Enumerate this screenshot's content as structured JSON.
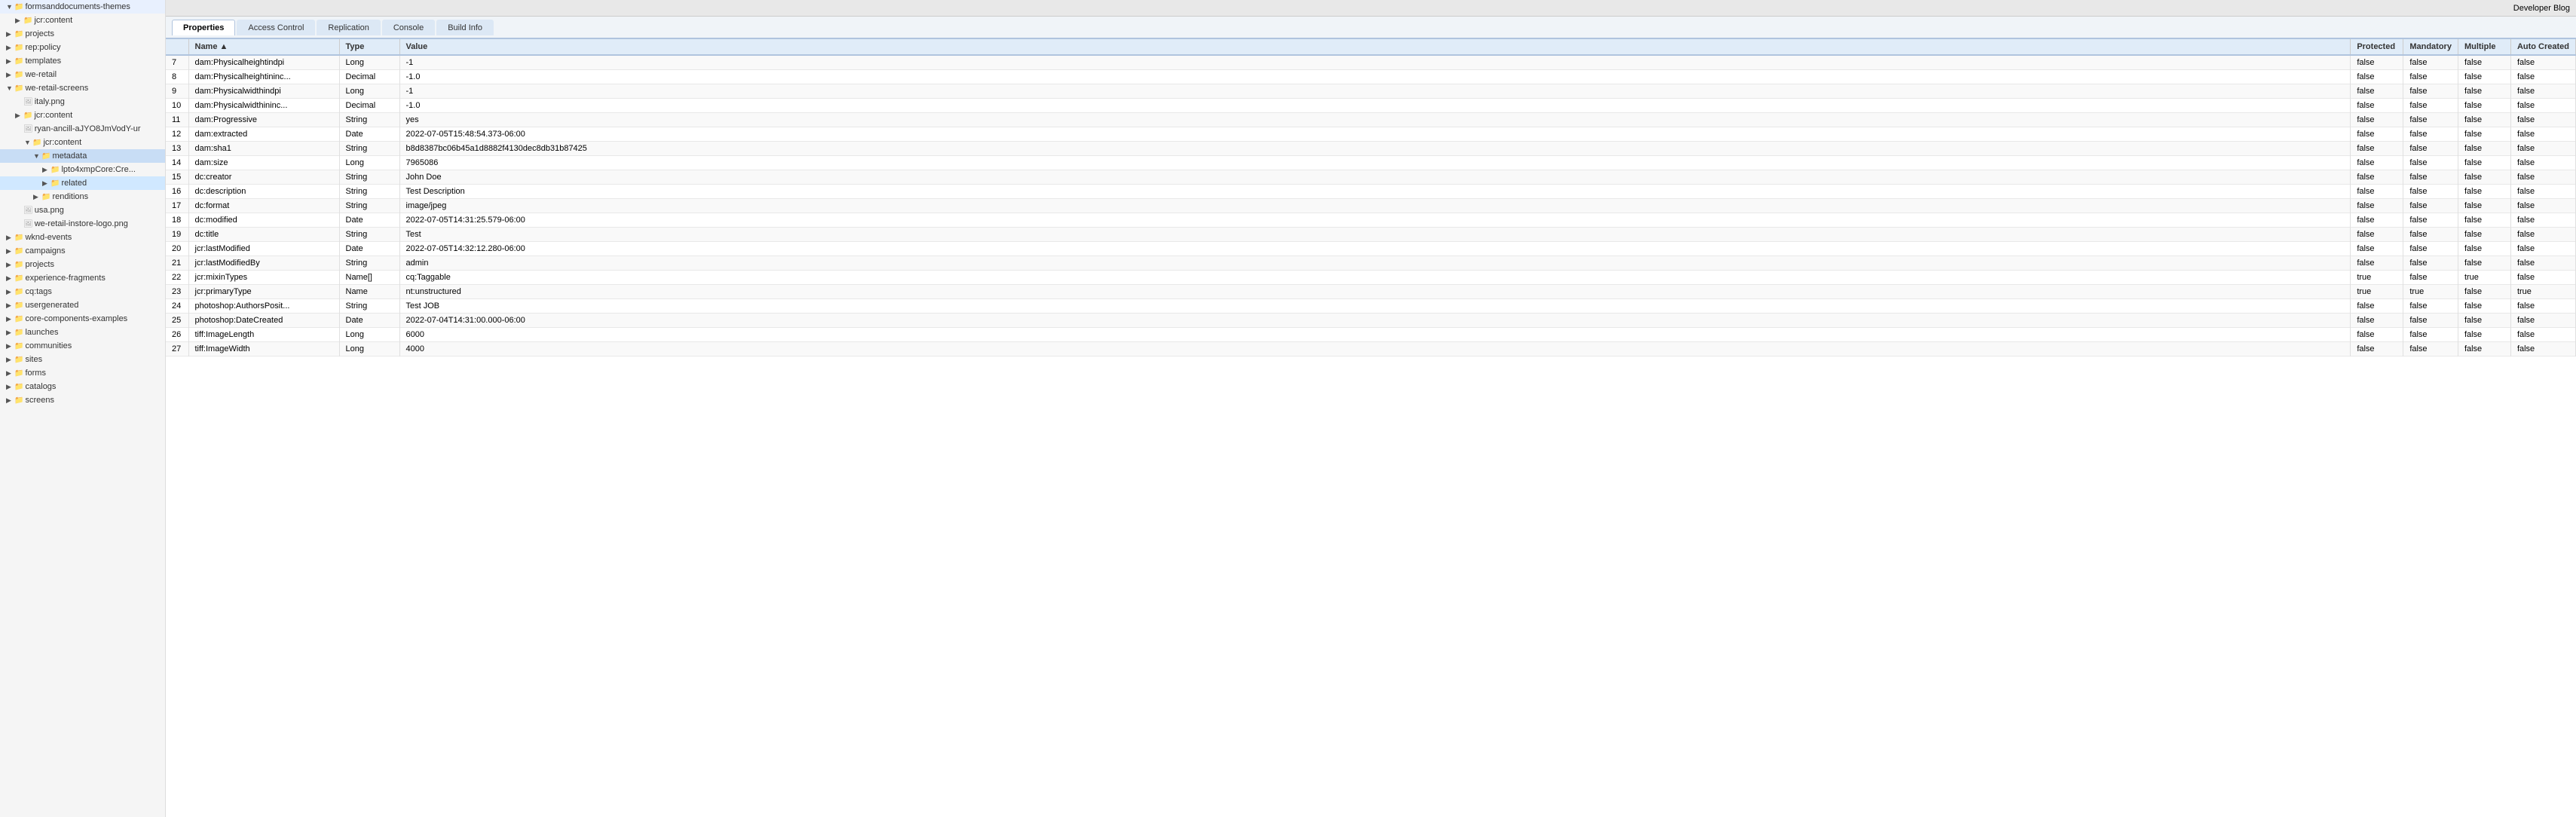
{
  "sidebar": {
    "items": [
      {
        "id": "formsanddocuments-themes",
        "label": "formsanddocuments-themes",
        "indent": 1,
        "type": "folder",
        "expanded": true
      },
      {
        "id": "jcr-content",
        "label": "jcr:content",
        "indent": 2,
        "type": "folder",
        "expanded": false
      },
      {
        "id": "projects",
        "label": "projects",
        "indent": 1,
        "type": "folder",
        "expanded": false
      },
      {
        "id": "rep-policy",
        "label": "rep:policy",
        "indent": 1,
        "type": "folder",
        "expanded": false
      },
      {
        "id": "templates",
        "label": "templates",
        "indent": 1,
        "type": "folder",
        "expanded": false
      },
      {
        "id": "we-retail",
        "label": "we-retail",
        "indent": 1,
        "type": "folder",
        "expanded": false
      },
      {
        "id": "we-retail-screens",
        "label": "we-retail-screens",
        "indent": 1,
        "type": "folder",
        "expanded": true
      },
      {
        "id": "italy-png",
        "label": "italy.png",
        "indent": 2,
        "type": "file-img",
        "expanded": false
      },
      {
        "id": "jcr-content-2",
        "label": "jcr:content",
        "indent": 2,
        "type": "folder",
        "expanded": false
      },
      {
        "id": "ryan-ancill",
        "label": "ryan-ancill-aJYO8JmVodY-ur",
        "indent": 2,
        "type": "file-img",
        "expanded": true
      },
      {
        "id": "jcr-content-3",
        "label": "jcr:content",
        "indent": 3,
        "type": "folder",
        "expanded": true
      },
      {
        "id": "metadata",
        "label": "metadata",
        "indent": 4,
        "type": "folder",
        "expanded": true,
        "selected": true
      },
      {
        "id": "lpto4xmpCore-Cre",
        "label": "lpto4xmpCore:Cre...",
        "indent": 5,
        "type": "folder",
        "expanded": false
      },
      {
        "id": "related",
        "label": "related",
        "indent": 5,
        "type": "folder",
        "expanded": false,
        "highlighted": true
      },
      {
        "id": "renditions",
        "label": "renditions",
        "indent": 4,
        "type": "folder",
        "expanded": false
      },
      {
        "id": "usa-png",
        "label": "usa.png",
        "indent": 2,
        "type": "file-img",
        "expanded": false
      },
      {
        "id": "we-retail-instore-logo",
        "label": "we-retail-instore-logo.png",
        "indent": 2,
        "type": "file-img",
        "expanded": false
      },
      {
        "id": "wknd-events",
        "label": "wknd-events",
        "indent": 1,
        "type": "folder",
        "expanded": false
      },
      {
        "id": "campaigns",
        "label": "campaigns",
        "indent": 1,
        "type": "folder",
        "expanded": false
      },
      {
        "id": "projects-2",
        "label": "projects",
        "indent": 1,
        "type": "folder",
        "expanded": false
      },
      {
        "id": "experience-fragments",
        "label": "experience-fragments",
        "indent": 1,
        "type": "folder",
        "expanded": false
      },
      {
        "id": "cq-tags",
        "label": "cq:tags",
        "indent": 1,
        "type": "folder",
        "expanded": false
      },
      {
        "id": "usergenerated",
        "label": "usergenerated",
        "indent": 1,
        "type": "folder",
        "expanded": false
      },
      {
        "id": "core-components-examples",
        "label": "core-components-examples",
        "indent": 1,
        "type": "folder",
        "expanded": false
      },
      {
        "id": "launches",
        "label": "launches",
        "indent": 1,
        "type": "folder",
        "expanded": false
      },
      {
        "id": "communities",
        "label": "communities",
        "indent": 1,
        "type": "folder",
        "expanded": false
      },
      {
        "id": "sites",
        "label": "sites",
        "indent": 1,
        "type": "folder",
        "expanded": false
      },
      {
        "id": "forms",
        "label": "forms",
        "indent": 1,
        "type": "folder",
        "expanded": false
      },
      {
        "id": "catalogs",
        "label": "catalogs",
        "indent": 1,
        "type": "folder",
        "expanded": false
      },
      {
        "id": "screens",
        "label": "screens",
        "indent": 1,
        "type": "folder",
        "expanded": false
      }
    ]
  },
  "topbar": {
    "developer_blog_label": "Developer Blog"
  },
  "tabs": [
    {
      "id": "properties",
      "label": "Properties",
      "active": true
    },
    {
      "id": "access-control",
      "label": "Access Control",
      "active": false
    },
    {
      "id": "replication",
      "label": "Replication",
      "active": false
    },
    {
      "id": "console",
      "label": "Console",
      "active": false
    },
    {
      "id": "build-info",
      "label": "Build Info",
      "active": false
    }
  ],
  "table": {
    "headers": [
      {
        "id": "num",
        "label": ""
      },
      {
        "id": "name",
        "label": "Name",
        "sort": "asc"
      },
      {
        "id": "type",
        "label": "Type"
      },
      {
        "id": "value",
        "label": "Value"
      },
      {
        "id": "protected",
        "label": "Protected"
      },
      {
        "id": "mandatory",
        "label": "Mandatory"
      },
      {
        "id": "multiple",
        "label": "Multiple"
      },
      {
        "id": "auto-created",
        "label": "Auto Created"
      }
    ],
    "rows": [
      {
        "num": 7,
        "name": "dam:Physicalheightindpi",
        "type": "Long",
        "value": "-1",
        "protected": "false",
        "mandatory": "false",
        "multiple": "false",
        "auto_created": "false",
        "highlighted": false
      },
      {
        "num": 8,
        "name": "dam:Physicalheightininc...",
        "type": "Decimal",
        "value": "-1.0",
        "protected": "false",
        "mandatory": "false",
        "multiple": "false",
        "auto_created": "false",
        "highlighted": false
      },
      {
        "num": 9,
        "name": "dam:Physicalwidthindpi",
        "type": "Long",
        "value": "-1",
        "protected": "false",
        "mandatory": "false",
        "multiple": "false",
        "auto_created": "false",
        "highlighted": false
      },
      {
        "num": 10,
        "name": "dam:Physicalwidthininc...",
        "type": "Decimal",
        "value": "-1.0",
        "protected": "false",
        "mandatory": "false",
        "multiple": "false",
        "auto_created": "false",
        "highlighted": false
      },
      {
        "num": 11,
        "name": "dam:Progressive",
        "type": "String",
        "value": "yes",
        "protected": "false",
        "mandatory": "false",
        "multiple": "false",
        "auto_created": "false",
        "highlighted": false
      },
      {
        "num": 12,
        "name": "dam:extracted",
        "type": "Date",
        "value": "2022-07-05T15:48:54.373-06:00",
        "protected": "false",
        "mandatory": "false",
        "multiple": "false",
        "auto_created": "false",
        "highlighted": false
      },
      {
        "num": 13,
        "name": "dam:sha1",
        "type": "String",
        "value": "b8d8387bc06b45a1d8882f4130dec8db31b87425",
        "protected": "false",
        "mandatory": "false",
        "multiple": "false",
        "auto_created": "false",
        "highlighted": false
      },
      {
        "num": 14,
        "name": "dam:size",
        "type": "Long",
        "value": "7965086",
        "protected": "false",
        "mandatory": "false",
        "multiple": "false",
        "auto_created": "false",
        "highlighted": false
      },
      {
        "num": 15,
        "name": "dc:creator",
        "type": "String",
        "value": "John Doe",
        "protected": "false",
        "mandatory": "false",
        "multiple": "false",
        "auto_created": "false",
        "highlighted": true
      },
      {
        "num": 16,
        "name": "dc:description",
        "type": "String",
        "value": "Test Description",
        "protected": "false",
        "mandatory": "false",
        "multiple": "false",
        "auto_created": "false",
        "highlighted": false
      },
      {
        "num": 17,
        "name": "dc:format",
        "type": "String",
        "value": "image/jpeg",
        "protected": "false",
        "mandatory": "false",
        "multiple": "false",
        "auto_created": "false",
        "highlighted": false
      },
      {
        "num": 18,
        "name": "dc:modified",
        "type": "Date",
        "value": "2022-07-05T14:31:25.579-06:00",
        "protected": "false",
        "mandatory": "false",
        "multiple": "false",
        "auto_created": "false",
        "highlighted": false
      },
      {
        "num": 19,
        "name": "dc:title",
        "type": "String",
        "value": "Test",
        "protected": "false",
        "mandatory": "false",
        "multiple": "false",
        "auto_created": "false",
        "highlighted": false
      },
      {
        "num": 20,
        "name": "jcr:lastModified",
        "type": "Date",
        "value": "2022-07-05T14:32:12.280-06:00",
        "protected": "false",
        "mandatory": "false",
        "multiple": "false",
        "auto_created": "false",
        "highlighted": false
      },
      {
        "num": 21,
        "name": "jcr:lastModifiedBy",
        "type": "String",
        "value": "admin",
        "protected": "false",
        "mandatory": "false",
        "multiple": "false",
        "auto_created": "false",
        "highlighted": false
      },
      {
        "num": 22,
        "name": "jcr:mixinTypes",
        "type": "Name[]",
        "value": "cq:Taggable",
        "protected": "true",
        "mandatory": "false",
        "multiple": "true",
        "auto_created": "false",
        "highlighted": false
      },
      {
        "num": 23,
        "name": "jcr:primaryType",
        "type": "Name",
        "value": "nt:unstructured",
        "protected": "true",
        "mandatory": "true",
        "multiple": "false",
        "auto_created": "true",
        "highlighted": false
      },
      {
        "num": 24,
        "name": "photoshop:AuthorsPosit...",
        "type": "String",
        "value": "Test JOB",
        "protected": "false",
        "mandatory": "false",
        "multiple": "false",
        "auto_created": "false",
        "highlighted": false
      },
      {
        "num": 25,
        "name": "photoshop:DateCreated",
        "type": "Date",
        "value": "2022-07-04T14:31:00.000-06:00",
        "protected": "false",
        "mandatory": "false",
        "multiple": "false",
        "auto_created": "false",
        "highlighted": false
      },
      {
        "num": 26,
        "name": "tiff:ImageLength",
        "type": "Long",
        "value": "6000",
        "protected": "false",
        "mandatory": "false",
        "multiple": "false",
        "auto_created": "false",
        "highlighted": false
      },
      {
        "num": 27,
        "name": "tiff:ImageWidth",
        "type": "Long",
        "value": "4000",
        "protected": "false",
        "mandatory": "false",
        "multiple": "false",
        "auto_created": "false",
        "highlighted": false
      }
    ]
  }
}
